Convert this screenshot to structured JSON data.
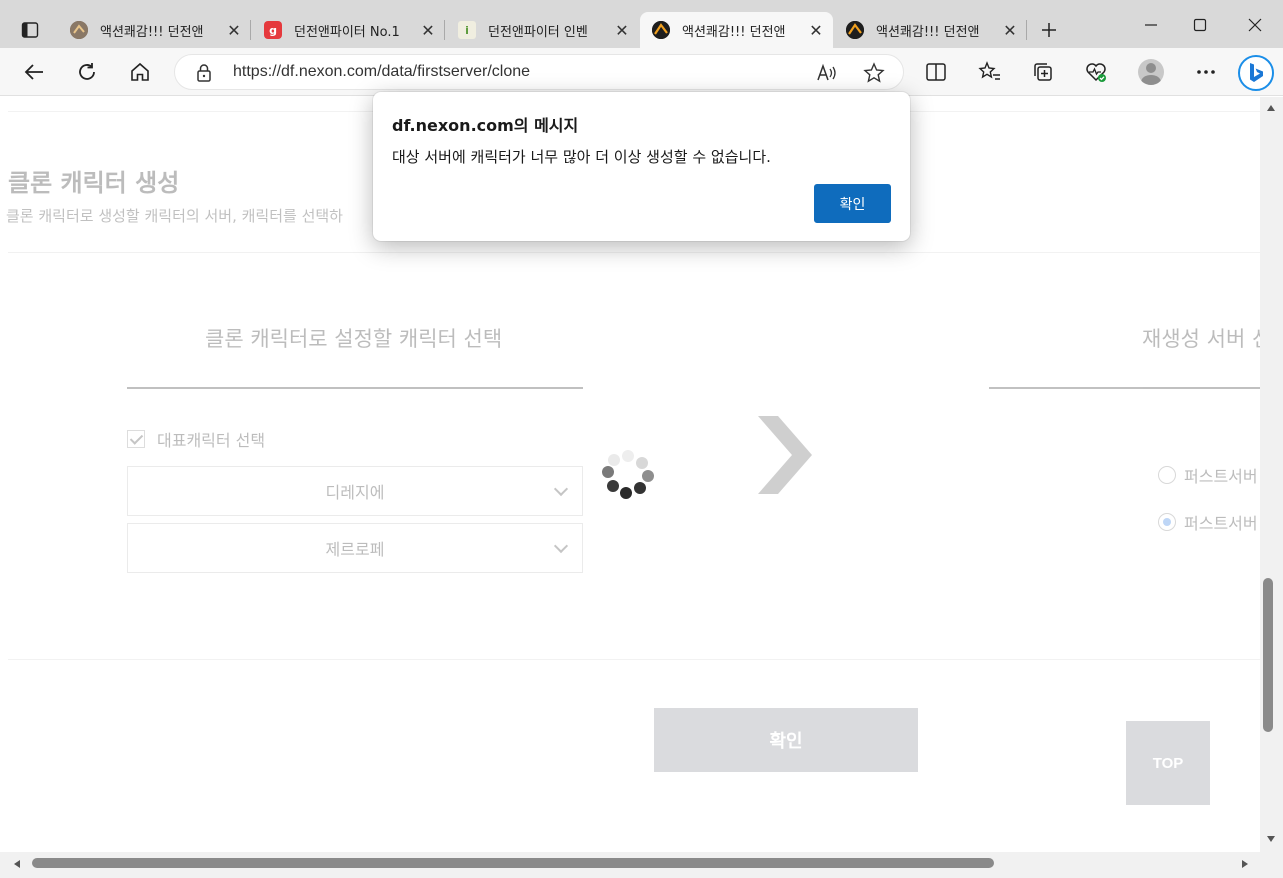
{
  "tabs": [
    {
      "title": "액션쾌감!!! 던전앤",
      "favicon": "dnf-logo-icon",
      "active": false
    },
    {
      "title": "던전앤파이터 No.1",
      "favicon": "g-letter-icon",
      "active": false
    },
    {
      "title": "던전앤파이터 인벤",
      "favicon": "inven-icon",
      "active": false
    },
    {
      "title": "액션쾌감!!! 던전앤",
      "favicon": "dnf-logo-icon",
      "active": true
    },
    {
      "title": "액션쾌감!!! 던전앤",
      "favicon": "dnf-logo-icon",
      "active": false
    }
  ],
  "address_bar": {
    "url": "https://df.nexon.com/data/firstserver/clone"
  },
  "page": {
    "title": "클론 캐릭터 생성",
    "subtitle": "클론 캐릭터로 생성할 캐릭터의 서버, 캐릭터를 선택하",
    "left_section_title": "클론 캐릭터로 설정할 캐릭터 선택",
    "right_section_title": "재생성 서버 선",
    "main_char_checkbox_label": "대표캐릭터 선택",
    "server_select_value": "디레지에",
    "character_select_value": "제르로페",
    "radio_options": [
      {
        "label": "퍼스트서버",
        "selected": false
      },
      {
        "label": "퍼스트서버",
        "selected": true
      }
    ],
    "confirm_label": "확인",
    "top_label": "TOP"
  },
  "dialog": {
    "title": "df.nexon.com의 메시지",
    "message": "대상 서버에 캐릭터가 너무 많아 더 이상 생성할 수 없습니다.",
    "ok_label": "확인"
  },
  "colors": {
    "accent": "#0f6cbd",
    "tabstrip": "#d9d9d9",
    "toolbar": "#f7f7f7",
    "disabled_button": "#dadbde"
  }
}
